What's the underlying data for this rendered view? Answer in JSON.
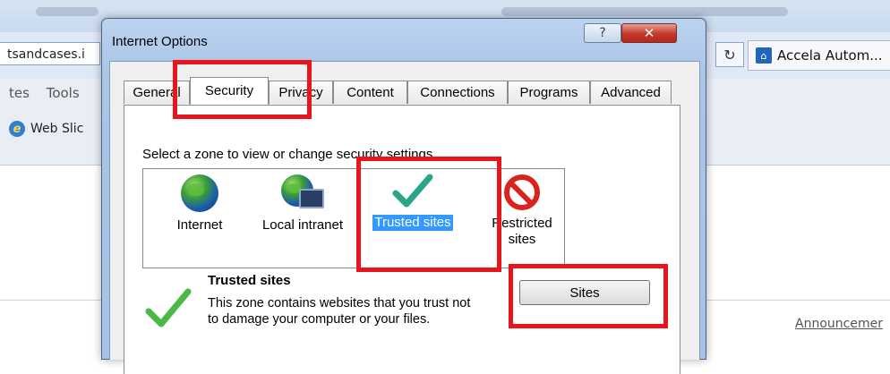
{
  "browser": {
    "address_fragment": "tsandcases.i",
    "menu_items": [
      "tes",
      "Tools"
    ],
    "web_slice_label": "Web Slic",
    "refresh_glyph": "↻",
    "tab_title": "Accela Autom...",
    "announcement_link": "Announcemer"
  },
  "dialog": {
    "title": "Internet Options",
    "help_glyph": "?",
    "close_glyph": "✕",
    "tabs": [
      "General",
      "Security",
      "Privacy",
      "Content",
      "Connections",
      "Programs",
      "Advanced"
    ],
    "active_tab": "Security",
    "zone_prompt": "Select a zone to view or change security settings.",
    "zones": [
      {
        "label": "Internet",
        "icon": "globe-icon"
      },
      {
        "label": "Local intranet",
        "icon": "local-intranet-icon"
      },
      {
        "label": "Trusted sites",
        "icon": "checkmark-icon",
        "selected": true
      },
      {
        "label": "Restricted sites",
        "icon": "restricted-icon"
      }
    ],
    "zone_info_title": "Trusted sites",
    "zone_info_desc": "This zone contains websites that you trust not to damage your computer or your files.",
    "sites_button": "Sites"
  },
  "colors": {
    "annotation_red": "#e8141e",
    "selection_blue": "#3399ff",
    "checkmark_teal": "#2aa58c"
  }
}
